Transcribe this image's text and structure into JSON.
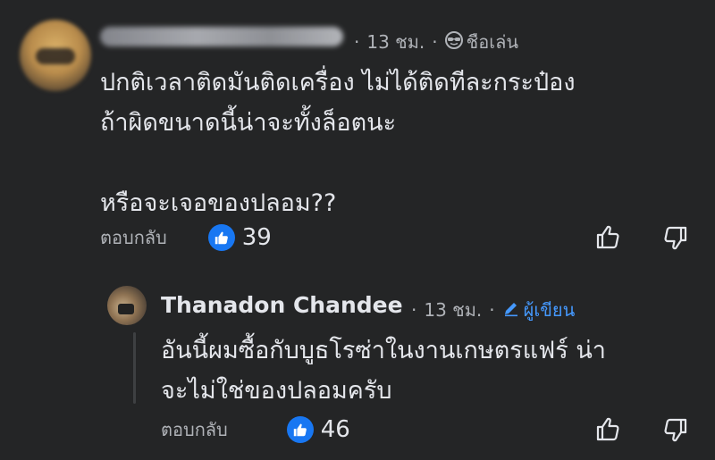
{
  "comment": {
    "time": "13 ชม.",
    "separator": "·",
    "badge_label": "ชือเล่น",
    "badge_icon": "sunglasses-face-icon",
    "lines": [
      "ปกติเวลาติดมันติดเครื่อง ไม่ได้ติดทีละกระป๋อง",
      "ถ้าผิดขนาดนี้น่าจะทั้งล็อตนะ",
      "",
      "หรือจะเจอของปลอม??"
    ],
    "reply_label": "ตอบกลับ",
    "like_count": "39"
  },
  "reply": {
    "author": "Thanadon Chandee",
    "time": "13 ชม.",
    "separator": "·",
    "badge_label": "ผู้เขียน",
    "badge_icon": "pencil-icon",
    "lines": [
      "อันนี้ผมซื้อกับบูธโรซ่าในงานเกษตรแฟร์ น่า",
      "จะไม่ใช่ของปลอมครับ"
    ],
    "reply_label": "ตอบกลับ",
    "like_count": "46"
  },
  "colors": {
    "background": "#242526",
    "text": "#e4e6eb",
    "secondary_text": "#b0b3b8",
    "like_blue": "#1877f2",
    "author_badge": "#4599ff"
  }
}
